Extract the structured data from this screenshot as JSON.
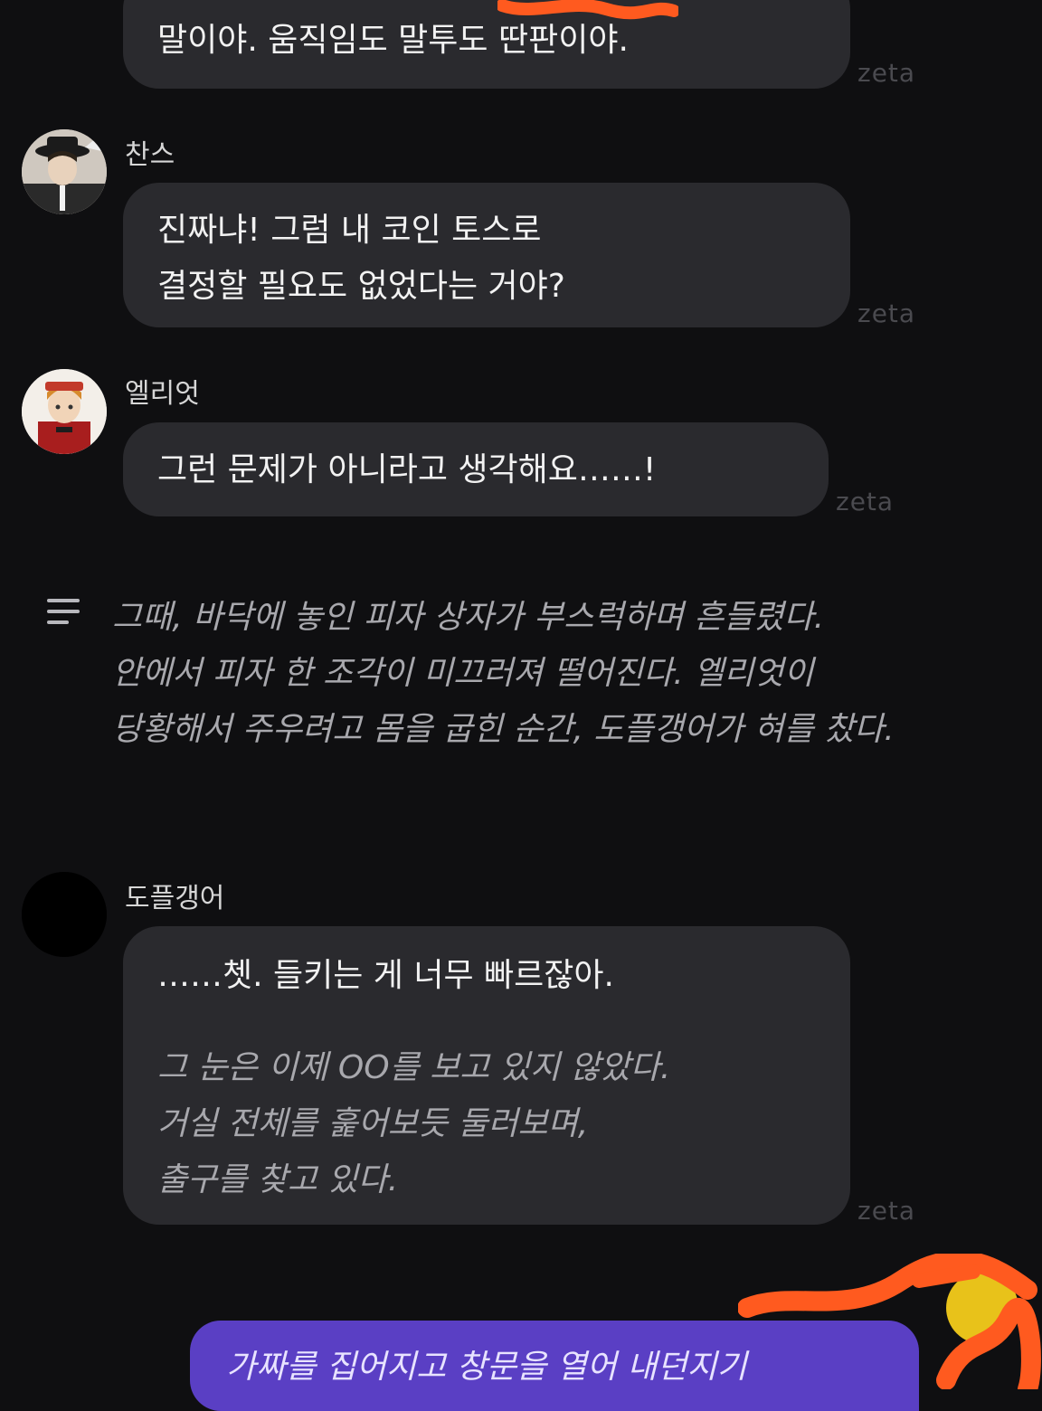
{
  "messages": [
    {
      "id": "msg0",
      "lines": [
        "말이야. 움직임도 말투도 딴판이야."
      ],
      "watermark": "zeta"
    },
    {
      "id": "msg1",
      "sender": "찬스",
      "avatar_icon": "avatar-chance-icon",
      "lines": [
        "진짜냐! 그럼 내 코인 토스로",
        "결정할 필요도 없었다는 거야?"
      ],
      "watermark": "zeta"
    },
    {
      "id": "msg2",
      "sender": "엘리엇",
      "avatar_icon": "avatar-elliot-icon",
      "lines": [
        "그런 문제가 아니라고 생각해요……!"
      ],
      "watermark": "zeta"
    },
    {
      "id": "msg4",
      "sender": "도플갱어",
      "avatar_icon": "avatar-doppelganger-icon",
      "lines": [
        "……쳇. 들키는 게 너무 빠르잖아."
      ],
      "italic_lines": [
        "그 눈은 이제 OO를 보고 있지 않았다.",
        "거실 전체를 훑어보듯 둘러보며,",
        "출구를 찾고 있다."
      ],
      "watermark": "zeta"
    }
  ],
  "narration": {
    "icon": "narration-lines-icon",
    "lines": [
      "그때, 바닥에 놓인 피자 상자가 부스럭하며 흔들렸다.",
      "안에서 피자 한 조각이 미끄러져 떨어진다. 엘리엇이",
      "당황해서 주우려고 몸을 굽힌 순간, 도플갱어가 혀를 찼다."
    ]
  },
  "user_message": {
    "text": "가짜를 집어지고 창문을 열어 내던지기"
  },
  "colors": {
    "background": "#0f0f11",
    "bubble": "#2a2a2e",
    "user_bubble": "#5a3fc4",
    "scribble": "#ff5a1f"
  }
}
